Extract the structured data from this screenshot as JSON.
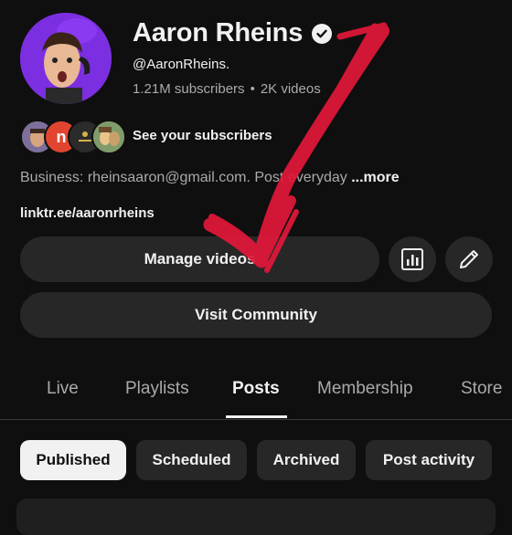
{
  "channel": {
    "name": "Aaron Rheins",
    "handle": "@AaronRheins.",
    "subscribers": "1.21M subscribers",
    "videos": "2K videos",
    "see_subscribers": "See your subscribers",
    "subscriber_avatar_letter": "n",
    "business_text": "Business: rheinsaaron@gmail.com. Post everyday",
    "more_label": "...more",
    "link": "linktr.ee/aaronrheins"
  },
  "buttons": {
    "manage_videos": "Manage videos",
    "visit_community": "Visit Community"
  },
  "tabs": [
    {
      "label": "Live"
    },
    {
      "label": "Playlists"
    },
    {
      "label": "Posts"
    },
    {
      "label": "Membership"
    },
    {
      "label": "Store"
    }
  ],
  "chips": [
    {
      "label": "Published"
    },
    {
      "label": "Scheduled"
    },
    {
      "label": "Archived"
    },
    {
      "label": "Post activity"
    }
  ],
  "icons": {
    "verified": "verified-check-icon",
    "analytics": "analytics-icon",
    "edit": "pencil-icon"
  },
  "colors": {
    "background": "#0f0f0f",
    "surface": "#272727",
    "arrow": "#e3173a"
  }
}
